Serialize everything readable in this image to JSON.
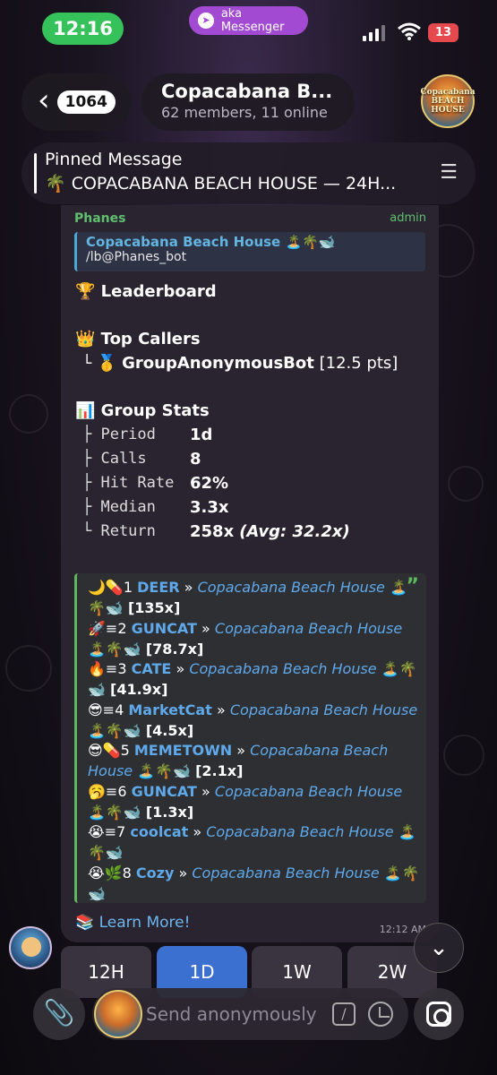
{
  "status_bar": {
    "time": "12:16",
    "messenger_label": "aka Messenger",
    "battery": "13"
  },
  "header": {
    "back_count": "1064",
    "title": "Copacabana B...",
    "subtitle": "62 members, 11 online",
    "avatar_text": "Copacabana BEACH HOUSE"
  },
  "pinned": {
    "label": "Pinned Message",
    "text": "🌴 COPACABANA BEACH HOUSE — 24H..."
  },
  "message": {
    "sender": "Phanes",
    "role": "admin",
    "reply_title": "Copacabana Beach House 🏝️🌴🐋",
    "reply_command": "/lb@Phanes_bot",
    "leaderboard_title": "🏆 Leaderboard",
    "top_callers_title": "👑 Top Callers",
    "top_caller_prefix": "└",
    "top_caller_medal": "🥇",
    "top_caller_name": "GroupAnonymousBot",
    "top_caller_pts": "[12.5 pts]",
    "group_stats_title": "📊 Group Stats",
    "stats": [
      {
        "label": "├ Period",
        "value": "1d"
      },
      {
        "label": "├ Calls",
        "value": "8"
      },
      {
        "label": "├ Hit Rate",
        "value": "62%"
      },
      {
        "label": "├ Median",
        "value": "3.3x"
      },
      {
        "label": "└ Return",
        "value": "258x",
        "extra": "(Avg: 32.2x)"
      }
    ],
    "calls": [
      {
        "prefix": "🌙💊1",
        "name": "DEER",
        "sep": "»",
        "group": "Copacabana Beach House",
        "emoji": "🏝️🌴🐋",
        "mult": "[135x]"
      },
      {
        "prefix": "🚀≡2",
        "name": "GUNCAT",
        "sep": "»",
        "group": "Copacabana Beach House",
        "emoji": "🏝️🌴🐋",
        "mult": "[78.7x]"
      },
      {
        "prefix": "🔥≡3",
        "name": "CATE",
        "sep": "»",
        "group": "Copacabana Beach House",
        "emoji": "🏝️🌴🐋",
        "mult": "[41.9x]"
      },
      {
        "prefix": "😎≡4",
        "name": "MarketCat",
        "sep": "»",
        "group": "Copacabana Beach House",
        "emoji": "🏝️🌴🐋",
        "mult": "[4.5x]"
      },
      {
        "prefix": "😎💊5",
        "name": "MEMETOWN",
        "sep": "»",
        "group": "Copacabana Beach House",
        "emoji": "🏝️🌴🐋",
        "mult": "[2.1x]"
      },
      {
        "prefix": "🥱≡6",
        "name": "GUNCAT",
        "sep": "»",
        "group": "Copacabana Beach House",
        "emoji": "🏝️🌴🐋",
        "mult": "[1.3x]"
      },
      {
        "prefix": "😭≡7",
        "name": "coolcat",
        "sep": "»",
        "group": "Copacabana Beach House",
        "emoji": "🏝️🌴🐋",
        "mult": ""
      },
      {
        "prefix": "😭🌿8",
        "name": "Cozy",
        "sep": "»",
        "group": "Copacabana Beach House",
        "emoji": "🏝️🌴🐋",
        "mult": ""
      }
    ],
    "learn_more": "📚 Learn More!",
    "time": "12:12 AM"
  },
  "keyboard": {
    "buttons": [
      "12H",
      "1D",
      "1W",
      "2W"
    ],
    "active": "1D"
  },
  "input": {
    "placeholder": "Send anonymously"
  },
  "colors": {
    "accent": "#3b6fd0",
    "link": "#5fa8ea",
    "admin": "#60c070",
    "pill": "#a24bd2",
    "time": "#35c25a"
  },
  "icons": [
    "telegram-icon",
    "signal-icon",
    "wifi-icon",
    "back-chevron-icon",
    "pin-list-icon",
    "chevron-down-icon",
    "paperclip-icon",
    "command-icon",
    "sticker-icon",
    "camera-icon"
  ]
}
